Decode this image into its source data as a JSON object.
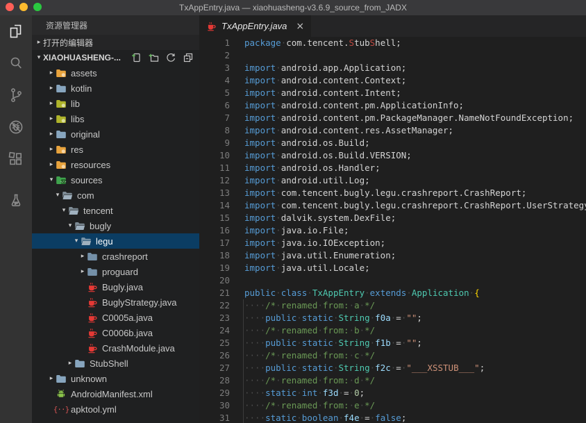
{
  "window": {
    "title": "TxAppEntry.java — xiaohuasheng-v3.6.9_source_from_JADX",
    "traffic_lights": [
      {
        "name": "close",
        "color": "#FF5F57"
      },
      {
        "name": "minimize",
        "color": "#FEBC2E"
      },
      {
        "name": "zoom",
        "color": "#2AC840"
      }
    ]
  },
  "activity_bar": {
    "items": [
      {
        "name": "explorer",
        "active": true
      },
      {
        "name": "search",
        "active": false
      },
      {
        "name": "source-control",
        "active": false
      },
      {
        "name": "debug-off",
        "active": false
      },
      {
        "name": "extensions",
        "active": false
      },
      {
        "name": "tests",
        "active": false
      }
    ]
  },
  "sidebar": {
    "title": "资源管理器",
    "open_editors": {
      "label": "打开的编辑器",
      "twisty": "▸"
    },
    "project": {
      "label": "XIAOHUASHENG-...",
      "twisty": "▾",
      "actions": [
        {
          "name": "new-file"
        },
        {
          "name": "new-folder"
        },
        {
          "name": "refresh"
        },
        {
          "name": "collapse-all"
        }
      ]
    },
    "tree": [
      {
        "label": "assets",
        "icon": "folder-yellow",
        "level": 1,
        "state": "collapsed"
      },
      {
        "label": "kotlin",
        "icon": "folder-blue",
        "level": 1,
        "state": "collapsed"
      },
      {
        "label": "lib",
        "icon": "folder-lime",
        "level": 1,
        "state": "collapsed"
      },
      {
        "label": "libs",
        "icon": "folder-lime",
        "level": 1,
        "state": "collapsed"
      },
      {
        "label": "original",
        "icon": "folder-blue",
        "level": 1,
        "state": "collapsed"
      },
      {
        "label": "res",
        "icon": "folder-yellow",
        "level": 1,
        "state": "collapsed"
      },
      {
        "label": "resources",
        "icon": "folder-yellow",
        "level": 1,
        "state": "collapsed"
      },
      {
        "label": "sources",
        "icon": "folder-src",
        "level": 1,
        "state": "expanded"
      },
      {
        "label": "com",
        "icon": "folder-open",
        "level": 2,
        "state": "expanded"
      },
      {
        "label": "tencent",
        "icon": "folder-open",
        "level": 3,
        "state": "expanded"
      },
      {
        "label": "bugly",
        "icon": "folder-open",
        "level": 4,
        "state": "expanded"
      },
      {
        "label": "legu",
        "icon": "folder-open",
        "level": 5,
        "state": "expanded",
        "selected": true
      },
      {
        "label": "crashreport",
        "icon": "folder-steel",
        "level": 6,
        "state": "collapsed"
      },
      {
        "label": "proguard",
        "icon": "folder-steel",
        "level": 6,
        "state": "collapsed"
      },
      {
        "label": "Bugly.java",
        "icon": "java",
        "level": 6,
        "state": "none"
      },
      {
        "label": "BuglyStrategy.java",
        "icon": "java",
        "level": 6,
        "state": "none"
      },
      {
        "label": "C0005a.java",
        "icon": "java",
        "level": 6,
        "state": "none"
      },
      {
        "label": "C0006b.java",
        "icon": "java",
        "level": 6,
        "state": "none"
      },
      {
        "label": "CrashModule.java",
        "icon": "java",
        "level": 6,
        "state": "none"
      },
      {
        "label": "StubShell",
        "icon": "folder-blue",
        "level": 4,
        "state": "collapsed"
      },
      {
        "label": "unknown",
        "icon": "folder-blue",
        "level": 1,
        "state": "collapsed"
      },
      {
        "label": "AndroidManifest.xml",
        "icon": "android",
        "level": 1,
        "state": "none"
      },
      {
        "label": "apktool.yml",
        "icon": "yml",
        "level": 1,
        "state": "none"
      }
    ]
  },
  "editor": {
    "tab": {
      "label": "TxAppEntry.java",
      "icon": "java",
      "close_glyph": "×"
    },
    "lines": [
      {
        "n": 1,
        "tokens": [
          {
            "c": "kw",
            "t": "package"
          },
          {
            "c": "pl",
            "t": " com.tencent."
          },
          {
            "c": "red",
            "t": "S"
          },
          {
            "c": "pl",
            "t": "tub"
          },
          {
            "c": "red",
            "t": "S"
          },
          {
            "c": "pl",
            "t": "hell;"
          }
        ]
      },
      {
        "n": 2,
        "tokens": []
      },
      {
        "n": 3,
        "tokens": [
          {
            "c": "kw",
            "t": "import"
          },
          {
            "c": "pl",
            "t": " android.app.Application;"
          }
        ]
      },
      {
        "n": 4,
        "tokens": [
          {
            "c": "kw",
            "t": "import"
          },
          {
            "c": "pl",
            "t": " android.content.Context;"
          }
        ]
      },
      {
        "n": 5,
        "tokens": [
          {
            "c": "kw",
            "t": "import"
          },
          {
            "c": "pl",
            "t": " android.content.Intent;"
          }
        ]
      },
      {
        "n": 6,
        "tokens": [
          {
            "c": "kw",
            "t": "import"
          },
          {
            "c": "pl",
            "t": " android.content.pm.ApplicationInfo;"
          }
        ]
      },
      {
        "n": 7,
        "tokens": [
          {
            "c": "kw",
            "t": "import"
          },
          {
            "c": "pl",
            "t": " android.content.pm.PackageManager.NameNotFoundException;"
          }
        ]
      },
      {
        "n": 8,
        "tokens": [
          {
            "c": "kw",
            "t": "import"
          },
          {
            "c": "pl",
            "t": " android.content.res.AssetManager;"
          }
        ]
      },
      {
        "n": 9,
        "tokens": [
          {
            "c": "kw",
            "t": "import"
          },
          {
            "c": "pl",
            "t": " android.os.Build;"
          }
        ]
      },
      {
        "n": 10,
        "tokens": [
          {
            "c": "kw",
            "t": "import"
          },
          {
            "c": "pl",
            "t": " android.os.Build.VERSION;"
          }
        ]
      },
      {
        "n": 11,
        "tokens": [
          {
            "c": "kw",
            "t": "import"
          },
          {
            "c": "pl",
            "t": " android.os.Handler;"
          }
        ]
      },
      {
        "n": 12,
        "tokens": [
          {
            "c": "kw",
            "t": "import"
          },
          {
            "c": "pl",
            "t": " android.util.Log;"
          }
        ]
      },
      {
        "n": 13,
        "tokens": [
          {
            "c": "kw",
            "t": "import"
          },
          {
            "c": "pl",
            "t": " com.tencent.bugly.legu.crashreport.CrashReport;"
          }
        ]
      },
      {
        "n": 14,
        "tokens": [
          {
            "c": "kw",
            "t": "import"
          },
          {
            "c": "pl",
            "t": " com.tencent.bugly.legu.crashreport.CrashReport.UserStrategy;"
          }
        ]
      },
      {
        "n": 15,
        "tokens": [
          {
            "c": "kw",
            "t": "import"
          },
          {
            "c": "pl",
            "t": " dalvik.system.DexFile;"
          }
        ]
      },
      {
        "n": 16,
        "tokens": [
          {
            "c": "kw",
            "t": "import"
          },
          {
            "c": "pl",
            "t": " java.io.File;"
          }
        ]
      },
      {
        "n": 17,
        "tokens": [
          {
            "c": "kw",
            "t": "import"
          },
          {
            "c": "pl",
            "t": " java.io.IOException;"
          }
        ]
      },
      {
        "n": 18,
        "tokens": [
          {
            "c": "kw",
            "t": "import"
          },
          {
            "c": "pl",
            "t": " java.util.Enumeration;"
          }
        ]
      },
      {
        "n": 19,
        "tokens": [
          {
            "c": "kw",
            "t": "import"
          },
          {
            "c": "pl",
            "t": " java.util.Locale;"
          }
        ]
      },
      {
        "n": 20,
        "tokens": []
      },
      {
        "n": 21,
        "tokens": [
          {
            "c": "kw",
            "t": "public"
          },
          {
            "c": "pl",
            "t": " "
          },
          {
            "c": "kw",
            "t": "class"
          },
          {
            "c": "pl",
            "t": " "
          },
          {
            "c": "ty",
            "t": "TxAppEntry"
          },
          {
            "c": "pl",
            "t": " "
          },
          {
            "c": "kw",
            "t": "extends"
          },
          {
            "c": "pl",
            "t": " "
          },
          {
            "c": "ty",
            "t": "Application"
          },
          {
            "c": "pl",
            "t": " "
          },
          {
            "c": "br",
            "t": "{"
          }
        ]
      },
      {
        "n": 22,
        "guide": true,
        "tokens": [
          {
            "c": "pl",
            "t": "    "
          },
          {
            "c": "cm",
            "t": "/* renamed from: a */"
          }
        ]
      },
      {
        "n": 23,
        "guide": true,
        "tokens": [
          {
            "c": "pl",
            "t": "    "
          },
          {
            "c": "kw",
            "t": "public"
          },
          {
            "c": "pl",
            "t": " "
          },
          {
            "c": "kw",
            "t": "static"
          },
          {
            "c": "pl",
            "t": " "
          },
          {
            "c": "ty",
            "t": "String"
          },
          {
            "c": "pl",
            "t": " "
          },
          {
            "c": "id",
            "t": "f0a"
          },
          {
            "c": "pl",
            "t": " = "
          },
          {
            "c": "st",
            "t": "\"\""
          },
          {
            "c": "pl",
            "t": ";"
          }
        ]
      },
      {
        "n": 24,
        "guide": true,
        "tokens": [
          {
            "c": "pl",
            "t": "    "
          },
          {
            "c": "cm",
            "t": "/* renamed from: b */"
          }
        ]
      },
      {
        "n": 25,
        "guide": true,
        "tokens": [
          {
            "c": "pl",
            "t": "    "
          },
          {
            "c": "kw",
            "t": "public"
          },
          {
            "c": "pl",
            "t": " "
          },
          {
            "c": "kw",
            "t": "static"
          },
          {
            "c": "pl",
            "t": " "
          },
          {
            "c": "ty",
            "t": "String"
          },
          {
            "c": "pl",
            "t": " "
          },
          {
            "c": "id",
            "t": "f1b"
          },
          {
            "c": "pl",
            "t": " = "
          },
          {
            "c": "st",
            "t": "\"\""
          },
          {
            "c": "pl",
            "t": ";"
          }
        ]
      },
      {
        "n": 26,
        "guide": true,
        "tokens": [
          {
            "c": "pl",
            "t": "    "
          },
          {
            "c": "cm",
            "t": "/* renamed from: c */"
          }
        ]
      },
      {
        "n": 27,
        "guide": true,
        "tokens": [
          {
            "c": "pl",
            "t": "    "
          },
          {
            "c": "kw",
            "t": "public"
          },
          {
            "c": "pl",
            "t": " "
          },
          {
            "c": "kw",
            "t": "static"
          },
          {
            "c": "pl",
            "t": " "
          },
          {
            "c": "ty",
            "t": "String"
          },
          {
            "c": "pl",
            "t": " "
          },
          {
            "c": "id",
            "t": "f2c"
          },
          {
            "c": "pl",
            "t": " = "
          },
          {
            "c": "st",
            "t": "\"___XSSTUB___\""
          },
          {
            "c": "pl",
            "t": ";"
          }
        ]
      },
      {
        "n": 28,
        "guide": true,
        "tokens": [
          {
            "c": "pl",
            "t": "    "
          },
          {
            "c": "cm",
            "t": "/* renamed from: d */"
          }
        ]
      },
      {
        "n": 29,
        "guide": true,
        "tokens": [
          {
            "c": "pl",
            "t": "    "
          },
          {
            "c": "kw",
            "t": "static"
          },
          {
            "c": "pl",
            "t": " "
          },
          {
            "c": "kw",
            "t": "int"
          },
          {
            "c": "pl",
            "t": " "
          },
          {
            "c": "id",
            "t": "f3d"
          },
          {
            "c": "pl",
            "t": " = "
          },
          {
            "c": "nu",
            "t": "0"
          },
          {
            "c": "pl",
            "t": ";"
          }
        ]
      },
      {
        "n": 30,
        "guide": true,
        "tokens": [
          {
            "c": "pl",
            "t": "    "
          },
          {
            "c": "cm",
            "t": "/* renamed from: e */"
          }
        ]
      },
      {
        "n": 31,
        "guide": true,
        "tokens": [
          {
            "c": "pl",
            "t": "    "
          },
          {
            "c": "kw",
            "t": "static"
          },
          {
            "c": "pl",
            "t": " "
          },
          {
            "c": "kw",
            "t": "boolean"
          },
          {
            "c": "pl",
            "t": " "
          },
          {
            "c": "id",
            "t": "f4e"
          },
          {
            "c": "pl",
            "t": " = "
          },
          {
            "c": "kw",
            "t": "false"
          },
          {
            "c": "pl",
            "t": ";"
          }
        ]
      }
    ]
  },
  "colors": {
    "selection_bg": "#0b3d63",
    "keyword": "#569CD6",
    "type": "#4EC9B0",
    "variable": "#9CDCFE",
    "string": "#CE9178",
    "number": "#B5CEA8",
    "comment": "#6A9955",
    "plain": "#D4D4D4",
    "bracket_gold": "#FFD700",
    "error_red": "#BE4A42",
    "java_icon": "#E53935",
    "android_green": "#8BC34A",
    "folder_yellow": "#E8A33D",
    "folder_lime": "#AFB42B",
    "folder_blue": "#87A5BE",
    "folder_steel": "#7490A8",
    "folder_open_gray": "#9FB0BE",
    "folder_src_green": "#3FA34D"
  }
}
